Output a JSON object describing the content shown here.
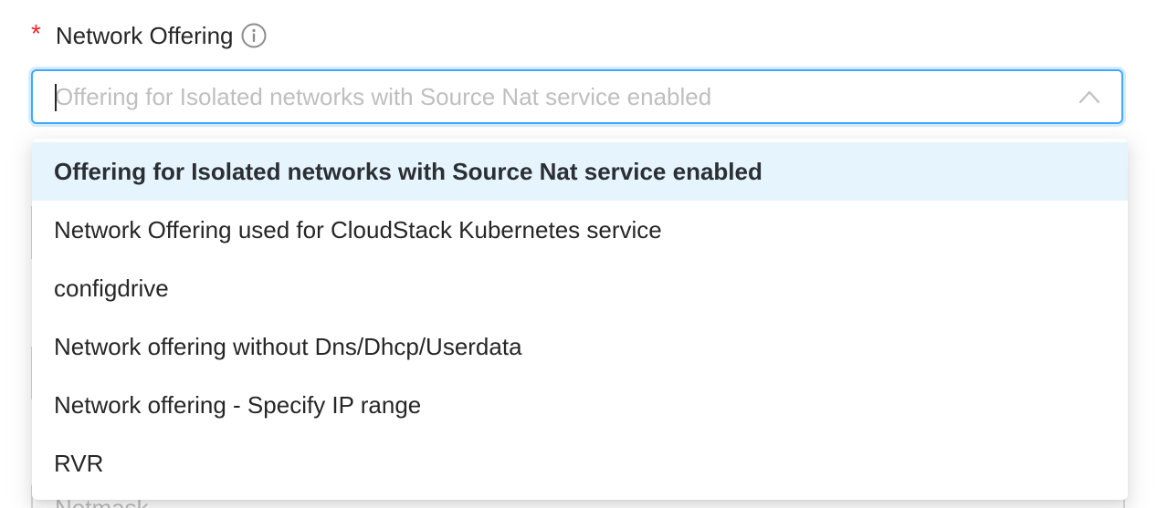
{
  "field": {
    "required_mark": "*",
    "label": "Network Offering",
    "info_icon": "info-circle-icon"
  },
  "select": {
    "placeholder": "Offering for Isolated networks with Source Nat service enabled",
    "value": "",
    "arrow_icon": "chevron-up-icon",
    "open": true
  },
  "dropdown": {
    "options": [
      {
        "label": "Offering for Isolated networks with Source Nat service enabled",
        "selected": true
      },
      {
        "label": "Network Offering used for CloudStack Kubernetes service",
        "selected": false
      },
      {
        "label": "configdrive",
        "selected": false
      },
      {
        "label": "Network offering without Dns/Dhcp/Userdata",
        "selected": false
      },
      {
        "label": "Network offering - Specify IP range",
        "selected": false
      },
      {
        "label": "RVR",
        "selected": false
      }
    ]
  },
  "behind": {
    "netmask_placeholder": "Netmask"
  },
  "colors": {
    "required": "#f5222d",
    "focus_border": "#40a9ff",
    "selected_option_bg": "#e6f4fe",
    "placeholder": "#bfbfbf"
  }
}
